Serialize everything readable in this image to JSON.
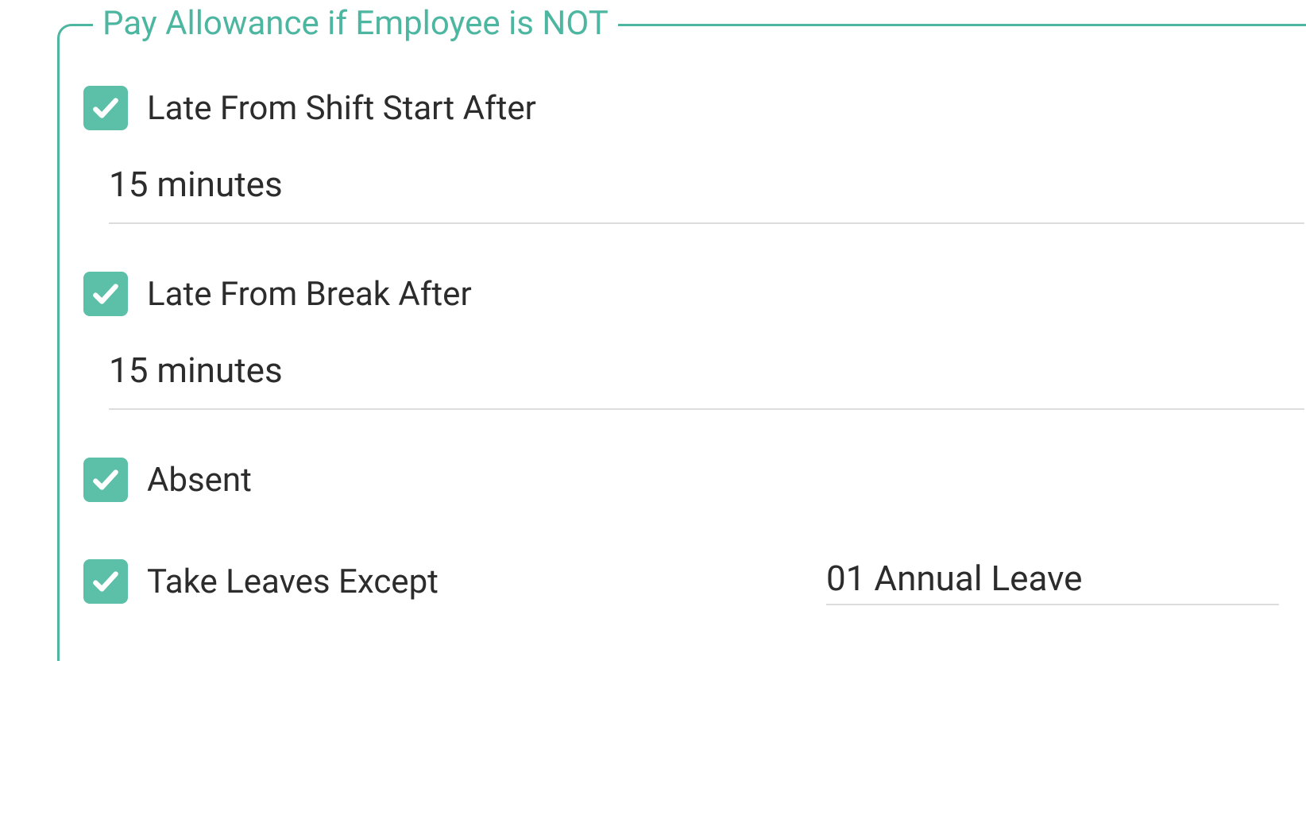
{
  "fieldset": {
    "legend": "Pay Allowance if Employee is NOT"
  },
  "conditions": {
    "lateShiftStart": {
      "label": "Late From Shift Start After",
      "value": "15 minutes",
      "checked": true
    },
    "lateBreak": {
      "label": "Late From Break After",
      "value": "15 minutes",
      "checked": true
    },
    "absent": {
      "label": "Absent",
      "checked": true
    },
    "takeLeaves": {
      "label": "Take Leaves Except",
      "value": "01 Annual Leave",
      "checked": true
    }
  },
  "colors": {
    "accent": "#4db6a0",
    "checkboxBg": "#5cbfa8",
    "text": "#2c2c2c",
    "border": "#dddddd"
  }
}
